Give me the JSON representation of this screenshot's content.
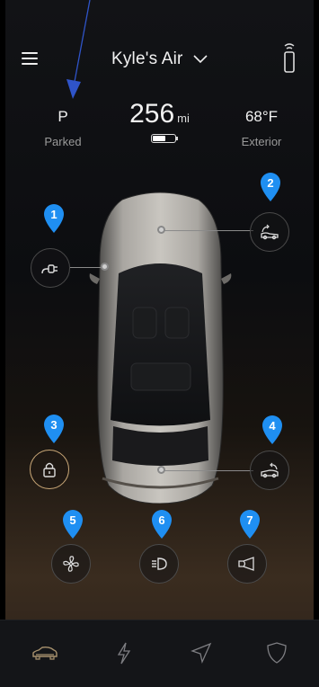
{
  "header": {
    "title": "Kyle's Air"
  },
  "status": {
    "gear": "P",
    "gear_label": "Parked"
  },
  "range": {
    "value": "256",
    "unit": "mi",
    "battery_level": 0.6
  },
  "exterior": {
    "temp": "68°F",
    "label": "Exterior"
  },
  "annotations": [
    "1",
    "2",
    "3",
    "4",
    "5",
    "6",
    "7"
  ],
  "colors": {
    "pin": "#1f8ff2",
    "lock_ring": "#c9a777",
    "annotation_arrow": "#2f54c9"
  },
  "controls": [
    {
      "name": "charge-port-icon",
      "label_pin": "1"
    },
    {
      "name": "frunk-icon",
      "label_pin": "2"
    },
    {
      "name": "lock-icon",
      "label_pin": "3"
    },
    {
      "name": "trunk-icon",
      "label_pin": "4"
    },
    {
      "name": "fan-icon",
      "label_pin": "5"
    },
    {
      "name": "headlights-icon",
      "label_pin": "6"
    },
    {
      "name": "horn-icon",
      "label_pin": "7"
    }
  ],
  "bottom_nav": [
    "car-icon",
    "lightning-icon",
    "navigation-icon",
    "shield-icon"
  ]
}
